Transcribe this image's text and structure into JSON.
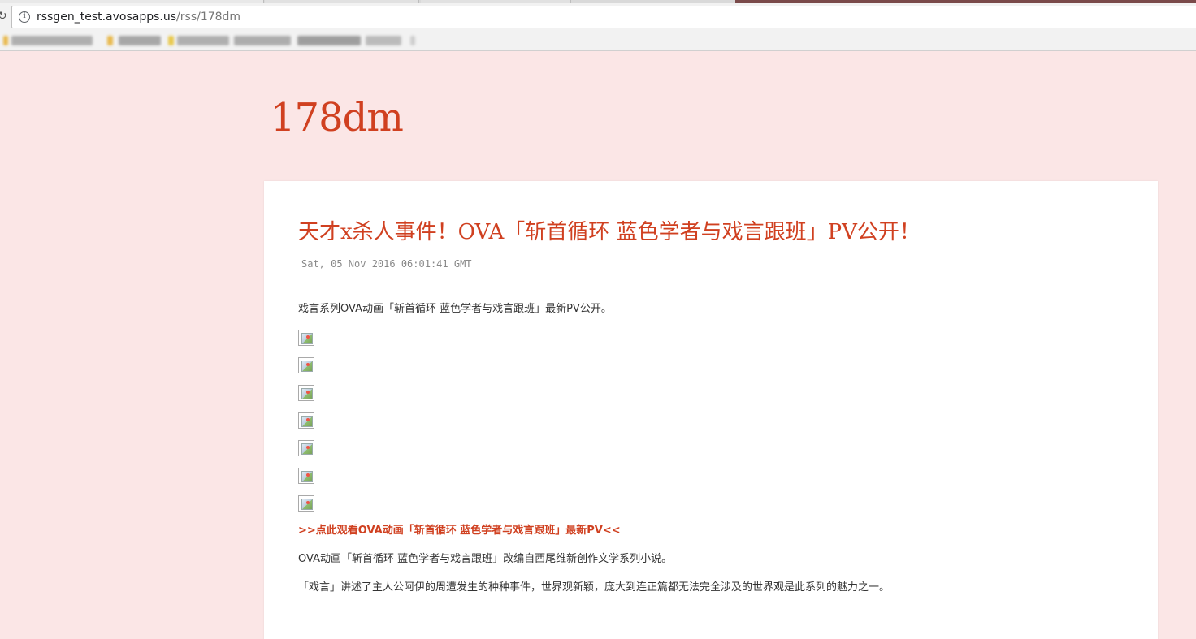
{
  "browser": {
    "url_host": "rssgen_test.avosapps.us",
    "url_path": "/rss/178dm"
  },
  "page": {
    "site_title": "178dm",
    "post": {
      "title": "天才x杀人事件！OVA「斩首循环 蓝色学者与戏言跟班」PV公开！",
      "date": "Sat, 05 Nov 2016 06:01:41 GMT",
      "intro": "戏言系列OVA动画「斩首循环 蓝色学者与戏言跟班」最新PV公开。",
      "image_count": 7,
      "watch_link": ">>点此观看OVA动画「斩首循环 蓝色学者与戏言跟班」最新PV<<",
      "para2": "OVA动画「斩首循环 蓝色学者与戏言跟班」改编自西尾维新创作文学系列小说。",
      "para3": "「戏言」讲述了主人公阿伊的周遭发生的种种事件，世界观新颖，庞大到连正篇都无法完全涉及的世界观是此系列的魅力之一。"
    }
  },
  "colors": {
    "page_bg": "#fbe6e6",
    "accent": "#d04020"
  }
}
